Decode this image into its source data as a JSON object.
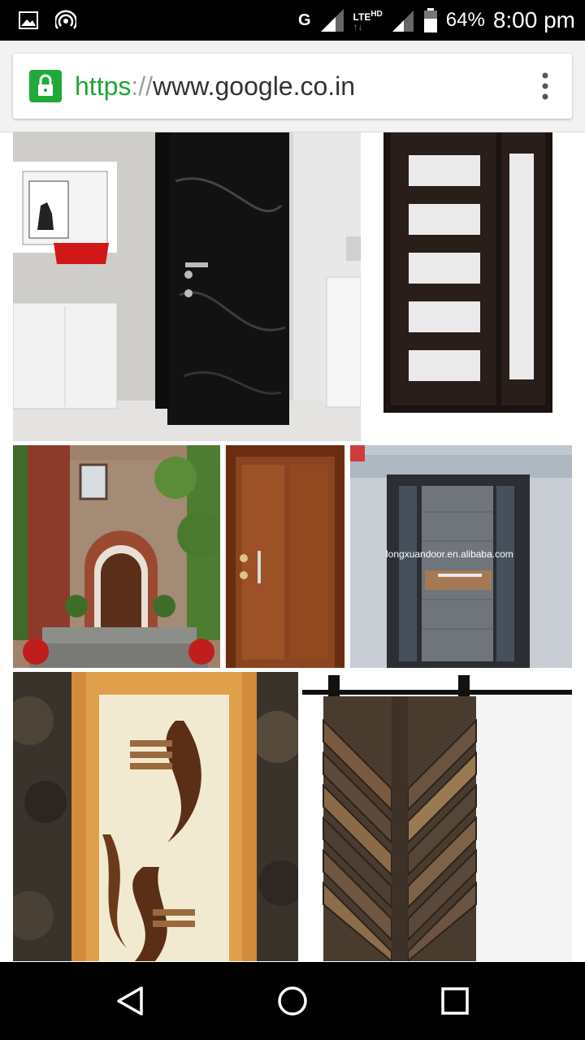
{
  "status_bar": {
    "network": "G",
    "lte_label": "LTE",
    "hd_label": "HD",
    "battery": "64%",
    "time": "8:00 pm",
    "icons": [
      "image-notification-icon",
      "hotspot-icon",
      "signal-icon",
      "battery-icon"
    ]
  },
  "address_bar": {
    "scheme": "https",
    "separator": "://",
    "host": "www.google.co.in",
    "icons": [
      "lock-icon",
      "overflow-menu-icon"
    ],
    "accent_color": "#1faa3a"
  },
  "results": {
    "watermark": "longxuandoor.en.alibaba.com",
    "images": [
      {
        "subject": "black textured interior door with white cabinet and red lamp"
      },
      {
        "subject": "dark wood door with five frosted glass panels and sidelight"
      },
      {
        "subject": "arched wooden front door in brick house with ivy"
      },
      {
        "subject": "wooden flush door with steel handle"
      },
      {
        "subject": "grey modern door with sidelights"
      },
      {
        "subject": "wooden door with cream wave design"
      },
      {
        "subject": "reclaimed wood herringbone barn door on rail"
      }
    ]
  },
  "nav_bar": {
    "icons": [
      "back-icon",
      "home-icon",
      "recents-icon"
    ]
  }
}
